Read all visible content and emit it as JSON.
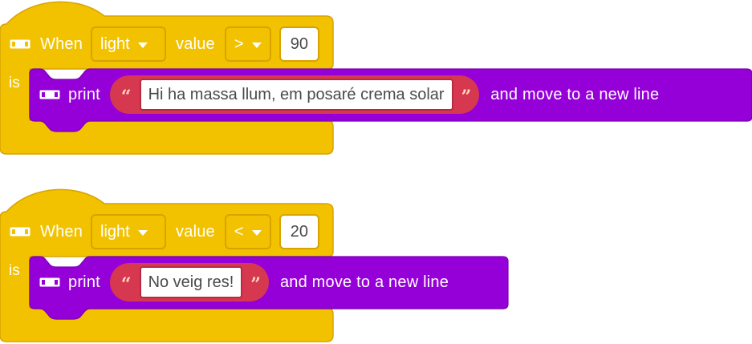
{
  "colors": {
    "event_block": "#f2c200",
    "event_block_border": "#d8a300",
    "print_block": "#9600d8",
    "print_block_border": "#7a00b4",
    "string_block": "#d6384f"
  },
  "blocks": [
    {
      "icon": "extension-icon",
      "when_label": "When",
      "sensor": "light",
      "value_label": "value",
      "operator": ">",
      "threshold": "90",
      "is_label": "is",
      "print": {
        "icon": "extension-icon",
        "label": "print",
        "text": "Hi ha massa llum, em posaré crema solar",
        "suffix": "and move to a new line"
      }
    },
    {
      "icon": "extension-icon",
      "when_label": "When",
      "sensor": "light",
      "value_label": "value",
      "operator": "<",
      "threshold": "20",
      "is_label": "is",
      "print": {
        "icon": "extension-icon",
        "label": "print",
        "text": "No veig res!",
        "suffix": "and move to a new line"
      }
    }
  ]
}
